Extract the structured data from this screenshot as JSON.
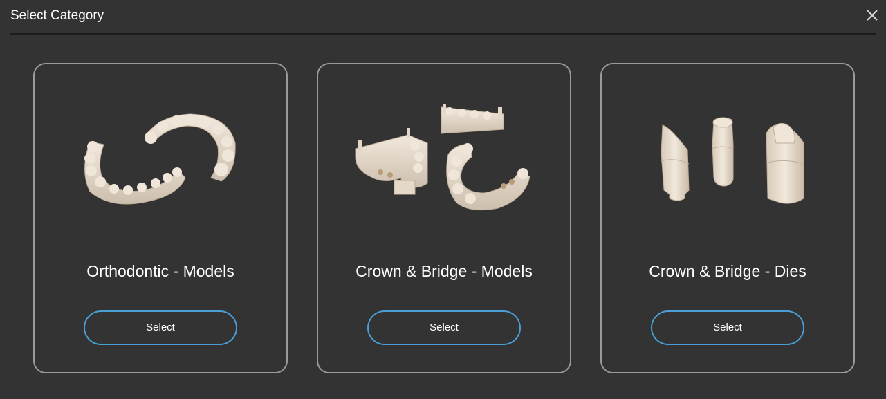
{
  "dialog": {
    "title": "Select Category",
    "close_icon": "close-icon"
  },
  "colors": {
    "background": "#333333",
    "card_border": "#9a9a9a",
    "button_border": "#4a9fd6",
    "model_material": "#e8ddd0"
  },
  "cards": [
    {
      "label": "Orthodontic - Models",
      "button_label": "Select",
      "image": "orthodontic-models-image"
    },
    {
      "label": "Crown & Bridge - Models",
      "button_label": "Select",
      "image": "crown-bridge-models-image"
    },
    {
      "label": "Crown & Bridge - Dies",
      "button_label": "Select",
      "image": "crown-bridge-dies-image"
    }
  ]
}
